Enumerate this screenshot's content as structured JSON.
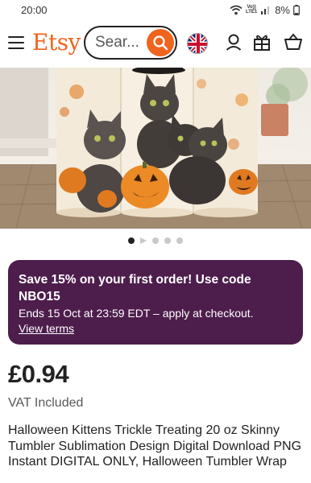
{
  "status_bar": {
    "time": "20:00",
    "network_top": "Vo))",
    "network_bottom": "LTE1",
    "battery": "8%"
  },
  "header": {
    "logo": "Etsy",
    "search_placeholder": "Sear...",
    "icons": [
      "menu-icon",
      "search-icon",
      "uk-flag-icon",
      "account-icon",
      "gift-icon",
      "basket-icon"
    ]
  },
  "carousel": {
    "image_count": 5,
    "active_index": 0
  },
  "promo": {
    "headline": "Save 15% on your first order! Use code NBO15",
    "subtext": "Ends 15 Oct at 23:59 EDT – apply at checkout.",
    "link": "View terms"
  },
  "product": {
    "price": "£0.94",
    "vat": "VAT Included",
    "title": "Halloween Kittens Trickle Treating 20 oz Skinny Tumbler Sublimation Design Digital Download PNG Instant DIGITAL ONLY, Halloween Tumbler Wrap"
  },
  "colors": {
    "brand_orange": "#f1641e",
    "promo_purple": "#4d1d4c"
  }
}
